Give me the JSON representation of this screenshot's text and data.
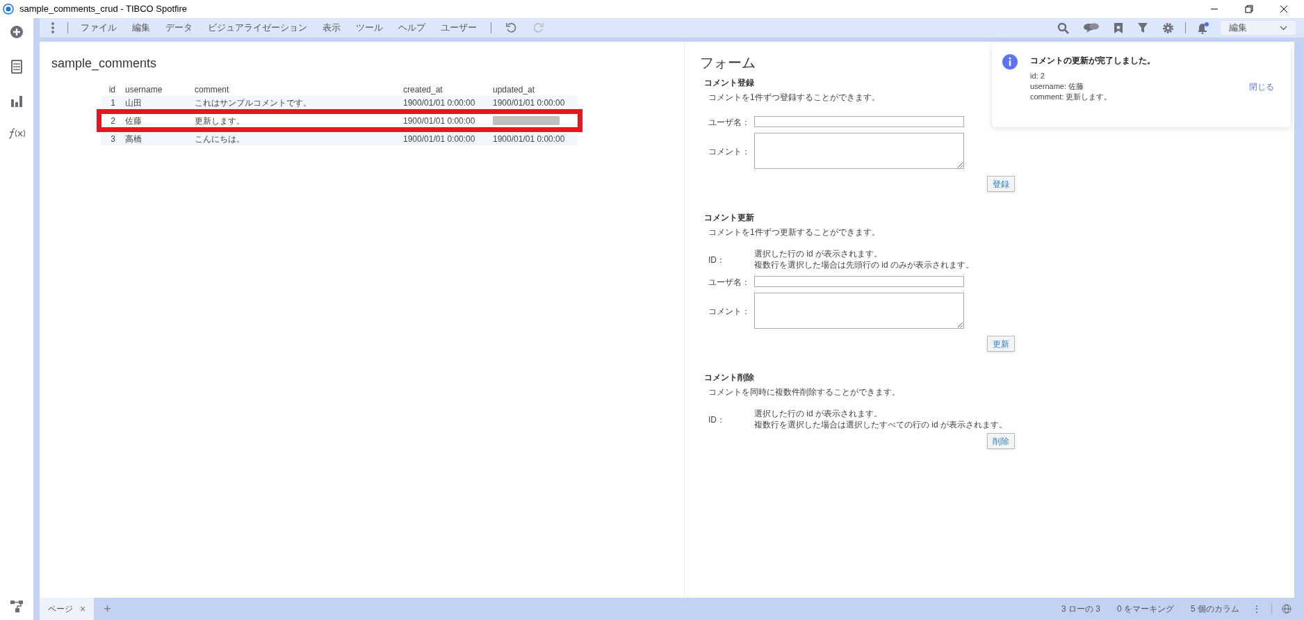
{
  "window": {
    "title": "sample_comments_crud - TIBCO Spotfire"
  },
  "menu": {
    "items": [
      "ファイル",
      "編集",
      "データ",
      "ビジュアライゼーション",
      "表示",
      "ツール",
      "ヘルプ",
      "ユーザー"
    ]
  },
  "mode_dropdown": {
    "value": "編集"
  },
  "table": {
    "title": "sample_comments",
    "columns": [
      "id",
      "username",
      "comment",
      "created_at",
      "updated_at"
    ],
    "rows": [
      {
        "id": "1",
        "username": "山田",
        "comment": "これはサンプルコメントです。",
        "created_at": "1900/01/01 0:00:00",
        "updated_at": "1900/01/01 0:00:00",
        "highlighted": false,
        "updated_at_redacted": false
      },
      {
        "id": "2",
        "username": "佐藤",
        "comment": "更新します。",
        "created_at": "1900/01/01 0:00:00",
        "highlighted": true,
        "updated_at_redacted": true
      },
      {
        "id": "3",
        "username": "高橋",
        "comment": "こんにちは。",
        "created_at": "1900/01/01 0:00:00",
        "updated_at": "1900/01/01 0:00:00",
        "highlighted": false,
        "updated_at_redacted": false
      }
    ]
  },
  "form": {
    "title": "フォーム",
    "sections": [
      {
        "title": "コメント登録",
        "description": "コメントを1件ずつ登録することができます。",
        "fields": [
          {
            "kind": "text",
            "label": "ユーザ名："
          },
          {
            "kind": "textarea",
            "label": "コメント："
          }
        ],
        "button": "登録"
      },
      {
        "title": "コメント更新",
        "description": "コメントを1件ずつ更新することができます。",
        "fields": [
          {
            "kind": "info",
            "label": "ID：",
            "lines": [
              "選択した行の id が表示されます。",
              "複数行を選択した場合は先頭行の id のみが表示されます。"
            ]
          },
          {
            "kind": "text",
            "label": "ユーザ名："
          },
          {
            "kind": "textarea",
            "label": "コメント："
          }
        ],
        "button": "更新"
      },
      {
        "title": "コメント削除",
        "description": "コメントを同時に複数件削除することができます。",
        "fields": [
          {
            "kind": "info",
            "label": "ID：",
            "lines": [
              "選択した行の id が表示されます。",
              "複数行を選択した場合は選択したすべての行の id が表示されます。"
            ]
          }
        ],
        "button": "削除"
      }
    ]
  },
  "notification": {
    "title": "コメントの更新が完了しました。",
    "lines": [
      "id: 2",
      "username: 佐藤",
      "comment: 更新します。"
    ],
    "close": "閉じる"
  },
  "status_bar": {
    "page_tab": "ページ",
    "page_close": "×",
    "add_page": "+",
    "items": [
      "3 ローの 3",
      "0 をマーキング",
      "5 個のカラム"
    ],
    "more": "⋮"
  }
}
